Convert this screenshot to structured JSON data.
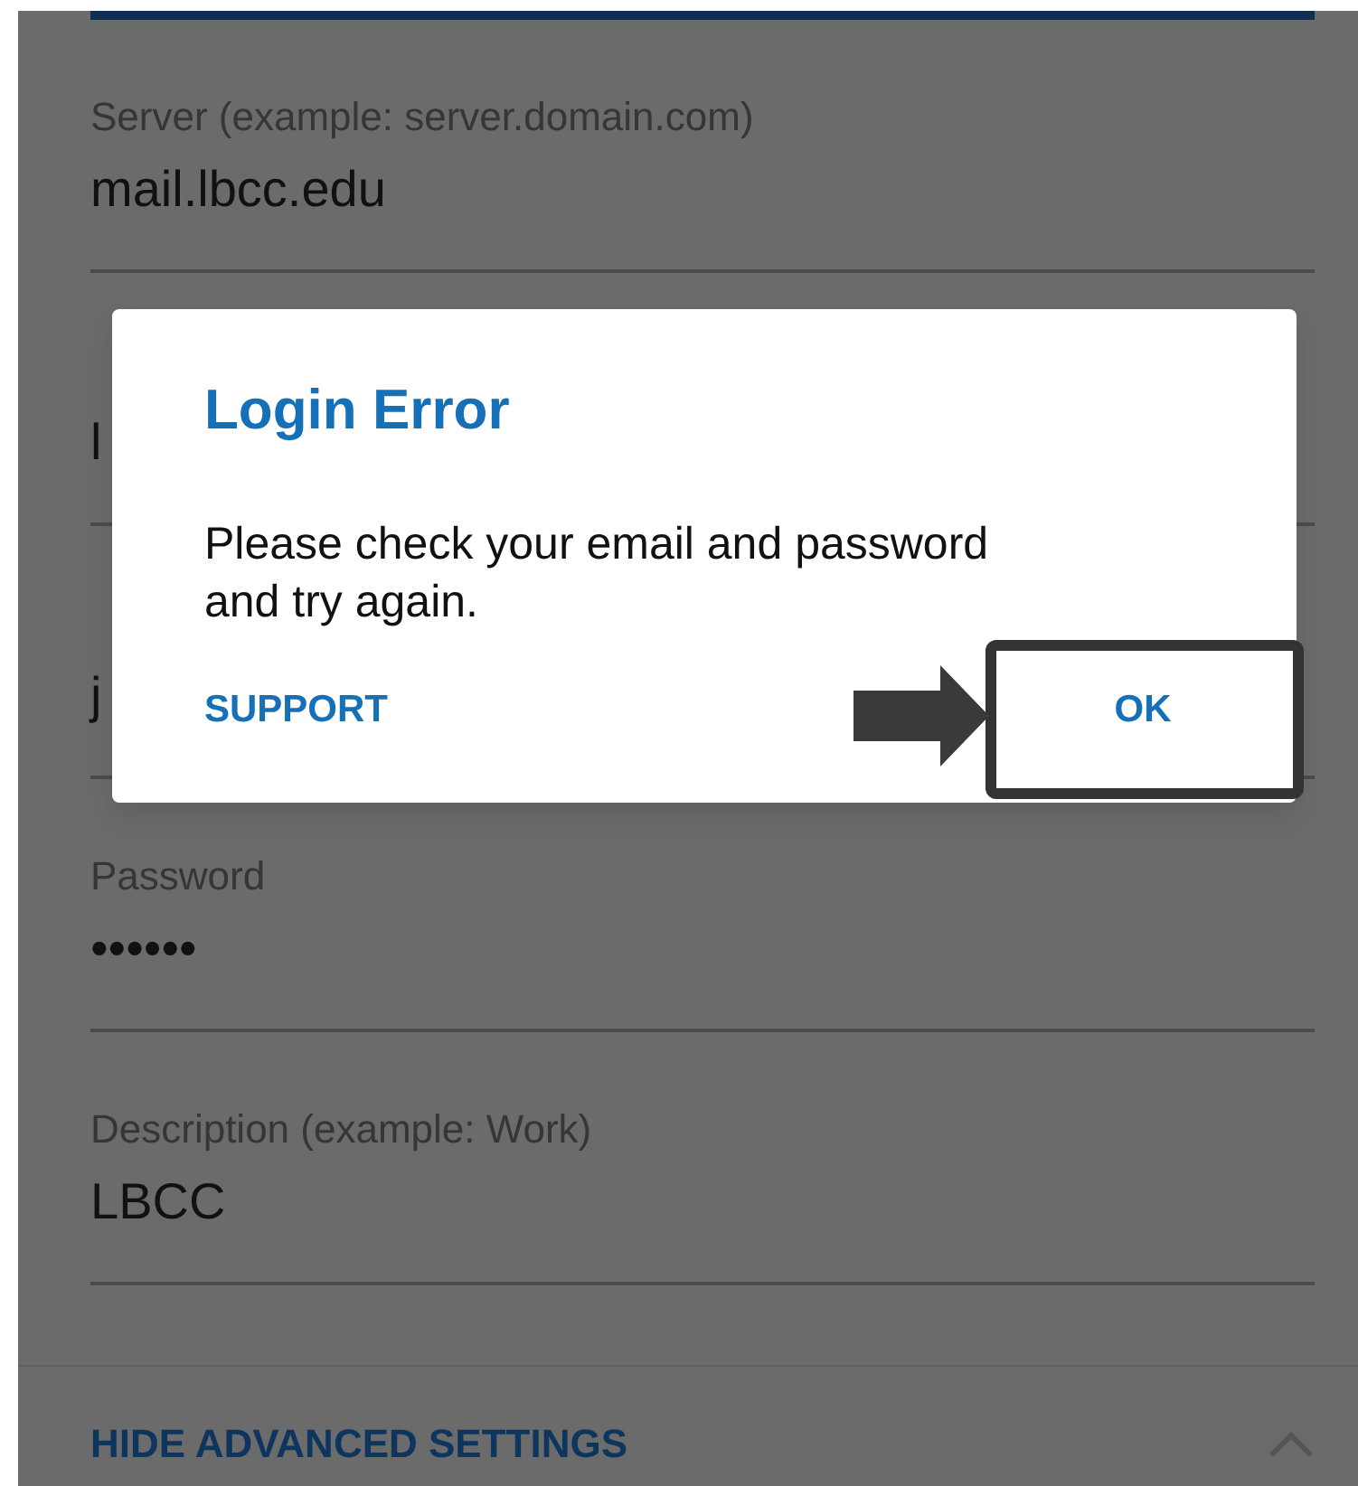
{
  "fields": [
    {
      "label": "Server (example: server.domain.com)",
      "value": "mail.lbcc.edu"
    },
    {
      "value": "l"
    },
    {
      "value": "j"
    },
    {
      "label": "Password",
      "value": "••••••"
    },
    {
      "label": "Description (example: Work)",
      "value": "LBCC"
    }
  ],
  "advanced": {
    "label": "HIDE ADVANCED SETTINGS",
    "expanded": true
  },
  "dialog": {
    "title": "Login Error",
    "message": "Please check your email and password and try again.",
    "buttons": [
      {
        "label": "SUPPORT",
        "highlighted": false
      },
      {
        "label": "OK",
        "highlighted": true
      }
    ]
  }
}
